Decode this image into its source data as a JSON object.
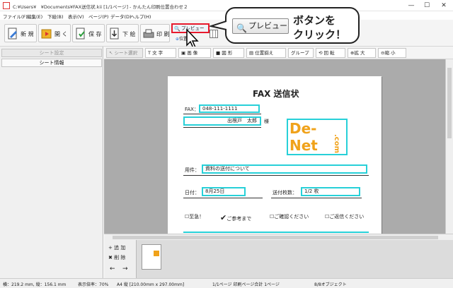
{
  "window": {
    "title": "C:¥Users¥　¥Documents¥FAX送信状.kii [1/1ページ] - かんたん印刷位置合わせ２",
    "minimize": "—",
    "maximize": "☐",
    "close": "✕"
  },
  "menu": [
    "ファイル(F)",
    "編集(E)",
    "下絵(B)",
    "表示(V)",
    "ページ(P)",
    "データ(D)",
    "ヘルプ(H)"
  ],
  "toolbar": {
    "new": "新 規",
    "open": "開 く",
    "save": "保 存",
    "sketch": "下 絵",
    "print": "印 刷",
    "preview": "プレビュー",
    "position": "位置"
  },
  "sidebar": {
    "tab_settings": "シート設定",
    "tab_info": "シート情報"
  },
  "drawbar": [
    "シート選択",
    "文 字",
    "画 像",
    "図 形",
    "位置揃え",
    "グループ",
    "回 転",
    "拡 大",
    "縮 小"
  ],
  "form": {
    "title": "FAX 送信状",
    "fax_label": "FAX：",
    "fax_value": "048-111-1111",
    "recipient": "出根戸　太郎",
    "recipient_suffix": "様",
    "logo_line1": "De-",
    "logo_line2": "Net",
    "logo_side": ".com",
    "subject_label": "用件：",
    "subject_value": "資料の送付について",
    "date_label": "日付：",
    "date_value": "8月25日",
    "pages_label": "送付枚数：",
    "pages_value": "1/2 枚",
    "check_urgent": "至急！",
    "check_reference": "ご参考まで",
    "check_confirm": "ご確認ください",
    "check_reply": "ご返信ください"
  },
  "thumbs": {
    "add": "追 加",
    "delete": "削 除",
    "prev": "←",
    "next": "→"
  },
  "status": {
    "coords": "横：219.2 mm, 縦：156.1 mm",
    "zoom": "表示倍率：70%",
    "paper": "A4 縦 [210.00mm x 297.00mm]",
    "pages": "1/1ページ 印刷ページ合計 1ページ",
    "objects": "8/8オブジェクト"
  },
  "callout": {
    "button_label": "プレビュー",
    "line1": "ボタンを",
    "line2": "クリック！"
  },
  "colors": {
    "highlight_red": "#e8192c",
    "field_cyan": "#27d0d8",
    "logo_orange": "#f0a21a"
  }
}
